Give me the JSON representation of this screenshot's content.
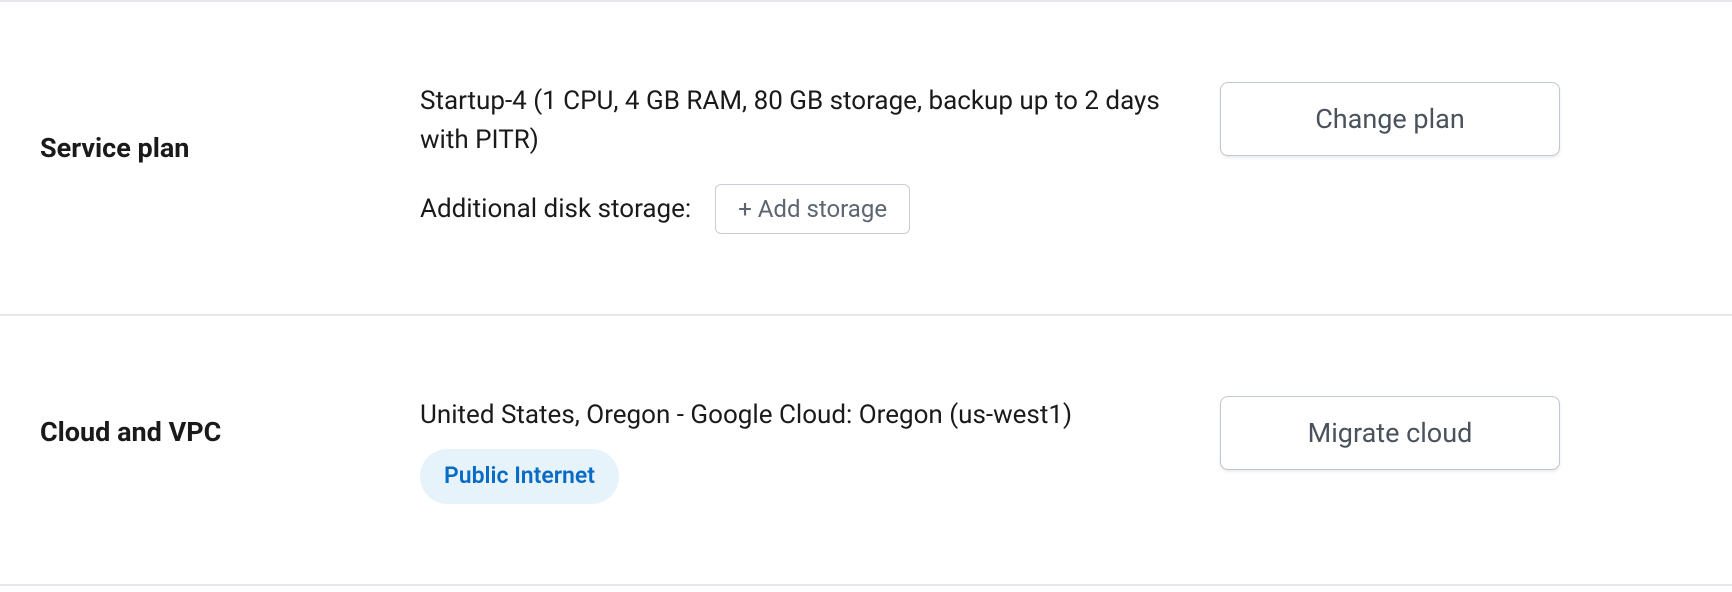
{
  "servicePlan": {
    "label": "Service plan",
    "description": "Startup-4 (1 CPU, 4 GB RAM, 80 GB storage, backup up to 2 days with PITR)",
    "additionalLabel": "Additional disk storage:",
    "addStorageButton": "+ Add storage",
    "changeButton": "Change plan"
  },
  "cloudVpc": {
    "label": "Cloud and VPC",
    "location": "United States, Oregon - Google Cloud: Oregon (us-west1)",
    "networkBadge": "Public Internet",
    "migrateButton": "Migrate cloud"
  }
}
